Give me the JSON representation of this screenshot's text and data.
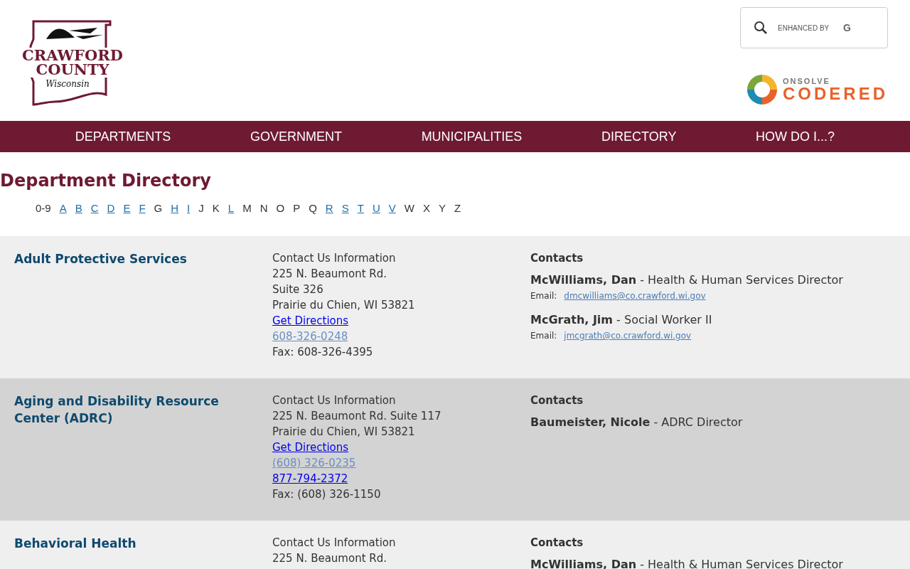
{
  "logo": {
    "line_1": "CRAWFORD",
    "line_2": "COUNTY",
    "line_3": "Wisconsin"
  },
  "search": {
    "placeholder": "ENHANCED BY",
    "brand": "G"
  },
  "alert_logo": {
    "top": "ONSOLVE",
    "bottom": "CODERED"
  },
  "nav": [
    "DEPARTMENTS",
    "GOVERNMENT",
    "MUNICIPALITIES",
    "DIRECTORY",
    "HOW DO I...?"
  ],
  "heading": "Department Directory",
  "letters": [
    {
      "label": "0-9",
      "link": false
    },
    {
      "label": "A",
      "link": true
    },
    {
      "label": "B",
      "link": true
    },
    {
      "label": "C",
      "link": true
    },
    {
      "label": "D",
      "link": true
    },
    {
      "label": "E",
      "link": true
    },
    {
      "label": "F",
      "link": true
    },
    {
      "label": "G",
      "link": false
    },
    {
      "label": "H",
      "link": true
    },
    {
      "label": "I",
      "link": true
    },
    {
      "label": "J",
      "link": false
    },
    {
      "label": "K",
      "link": false
    },
    {
      "label": "L",
      "link": true
    },
    {
      "label": "M",
      "link": false
    },
    {
      "label": "N",
      "link": false
    },
    {
      "label": "O",
      "link": false
    },
    {
      "label": "P",
      "link": false
    },
    {
      "label": "Q",
      "link": false
    },
    {
      "label": "R",
      "link": true
    },
    {
      "label": "S",
      "link": true
    },
    {
      "label": "T",
      "link": true
    },
    {
      "label": "U",
      "link": true
    },
    {
      "label": "V",
      "link": true
    },
    {
      "label": "W",
      "link": false
    },
    {
      "label": "X",
      "link": false
    },
    {
      "label": "Y",
      "link": false
    },
    {
      "label": "Z",
      "link": false
    }
  ],
  "departments": [
    {
      "name": "Adult Protective Services",
      "info": [
        {
          "kind": "text",
          "text": "Contact Us Information"
        },
        {
          "kind": "text",
          "text": "225 N. Beaumont Rd."
        },
        {
          "kind": "text",
          "text": "Suite 326"
        },
        {
          "kind": "text",
          "text": "Prairie du Chien, WI 53821"
        },
        {
          "kind": "link",
          "text": "Get Directions"
        },
        {
          "kind": "visited",
          "text": "608-326-0248"
        },
        {
          "kind": "text",
          "text": "Fax: 608-326-4395"
        }
      ],
      "contacts_label": "Contacts",
      "contacts": [
        {
          "name": "McWilliams, Dan",
          "title": " - Health & Human Services Director",
          "email_label": "Email:",
          "email": "dmcwilliams@co.crawford.wi.gov"
        },
        {
          "name": "McGrath, Jim",
          "title": " - Social Worker II",
          "email_label": "Email:",
          "email": "jmcgrath@co.crawford.wi.gov"
        }
      ]
    },
    {
      "name": "Aging and Disability Resource Center (ADRC)",
      "info": [
        {
          "kind": "text",
          "text": "Contact Us Information"
        },
        {
          "kind": "text",
          "text": "225 N. Beaumont Rd. Suite 117"
        },
        {
          "kind": "text",
          "text": "Prairie du Chien, WI 53821"
        },
        {
          "kind": "link",
          "text": "Get Directions"
        },
        {
          "kind": "visited",
          "text": "(608) 326-0235"
        },
        {
          "kind": "link",
          "text": "877-794-2372"
        },
        {
          "kind": "text",
          "text": "Fax: (608) 326-1150"
        }
      ],
      "contacts_label": "Contacts",
      "contacts": [
        {
          "name": "Baumeister, Nicole",
          "title": " - ADRC Director"
        }
      ]
    },
    {
      "name": "Behavioral Health",
      "info": [
        {
          "kind": "text",
          "text": "Contact Us Information"
        },
        {
          "kind": "text",
          "text": "225 N. Beaumont Rd."
        }
      ],
      "contacts_label": "Contacts",
      "contacts": [
        {
          "name": "McWilliams, Dan",
          "title": " - Health & Human Services Director"
        }
      ]
    }
  ]
}
